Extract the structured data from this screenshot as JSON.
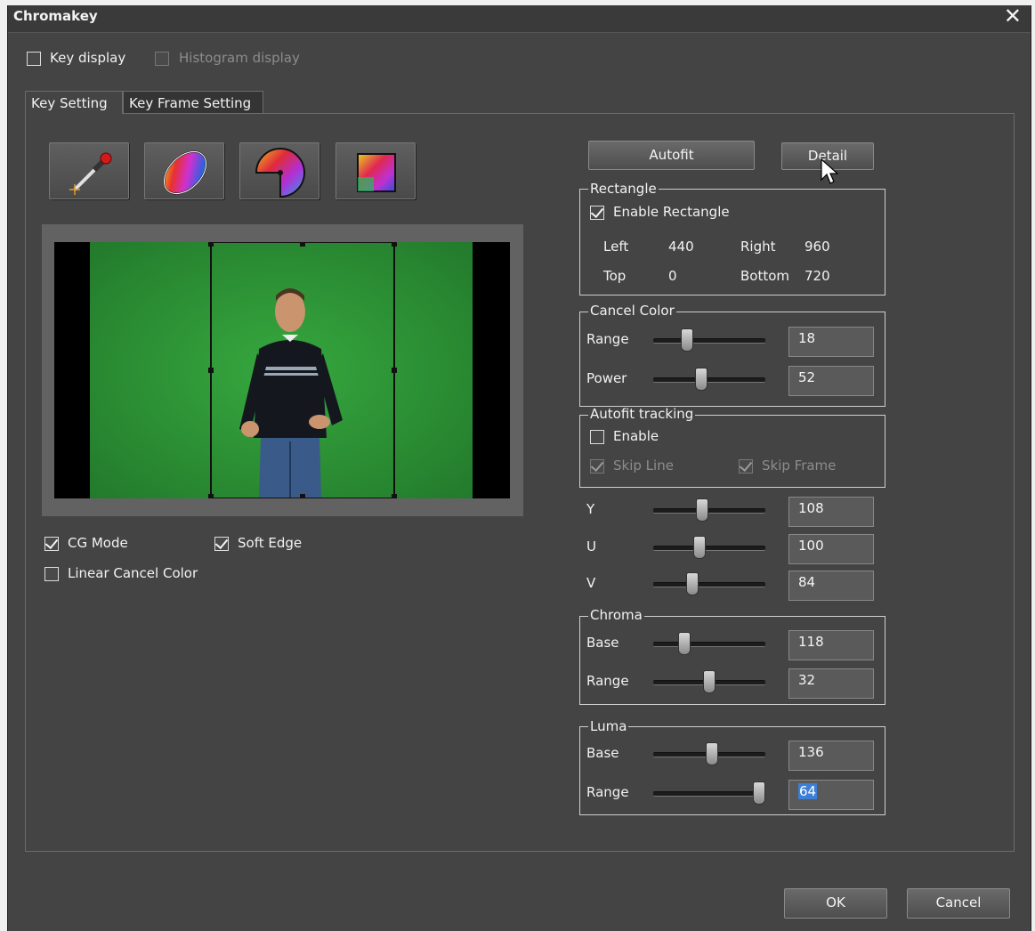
{
  "window": {
    "title": "Chromakey",
    "close_label": "✕"
  },
  "top_options": {
    "key_display": {
      "label": "Key display",
      "checked": false
    },
    "histogram_display": {
      "label": "Histogram display",
      "checked": false,
      "disabled": true
    }
  },
  "tabs": [
    {
      "label": "Key Setting",
      "active": true
    },
    {
      "label": "Key Frame Setting",
      "active": false
    }
  ],
  "tools": [
    "eyedropper-icon",
    "ellipse-color-icon",
    "pie-color-icon",
    "rectangle-color-icon"
  ],
  "options": {
    "cg_mode": {
      "label": "CG Mode",
      "checked": true
    },
    "soft_edge": {
      "label": "Soft Edge",
      "checked": true
    },
    "linear_cancel_color": {
      "label": "Linear Cancel Color",
      "checked": false
    }
  },
  "buttons": {
    "autofit": "Autofit",
    "detail": "Detail",
    "ok": "OK",
    "cancel": "Cancel"
  },
  "rectangle": {
    "legend": "Rectangle",
    "enable_label": "Enable Rectangle",
    "enabled": true,
    "left_label": "Left",
    "left": "440",
    "right_label": "Right",
    "right": "960",
    "top_label": "Top",
    "top": "0",
    "bottom_label": "Bottom",
    "bottom": "720"
  },
  "cancel_color": {
    "legend": "Cancel Color",
    "range": {
      "label": "Range",
      "value": "18",
      "level": 0.28
    },
    "power": {
      "label": "Power",
      "value": "52",
      "level": 0.42
    }
  },
  "autofit_tracking": {
    "legend": "Autofit tracking",
    "enable_label": "Enable",
    "enabled": false,
    "skip_line_label": "Skip Line",
    "skip_line": true,
    "skip_frame_label": "Skip Frame",
    "skip_frame": true
  },
  "yuv": {
    "y": {
      "label": "Y",
      "value": "108",
      "level": 0.43
    },
    "u": {
      "label": "U",
      "value": "100",
      "level": 0.4
    },
    "v": {
      "label": "V",
      "value": "84",
      "level": 0.33
    }
  },
  "chroma": {
    "legend": "Chroma",
    "base": {
      "label": "Base",
      "value": "118",
      "level": 0.25
    },
    "range": {
      "label": "Range",
      "value": "32",
      "level": 0.5
    }
  },
  "luma": {
    "legend": "Luma",
    "base": {
      "label": "Base",
      "value": "136",
      "level": 0.53
    },
    "range": {
      "label": "Range",
      "value": "64",
      "level": 1.0,
      "selected": true
    }
  },
  "colors": {
    "window_bg": "#444444",
    "green_screen": "#2f9a3a",
    "selection": "#3b7fd6"
  }
}
